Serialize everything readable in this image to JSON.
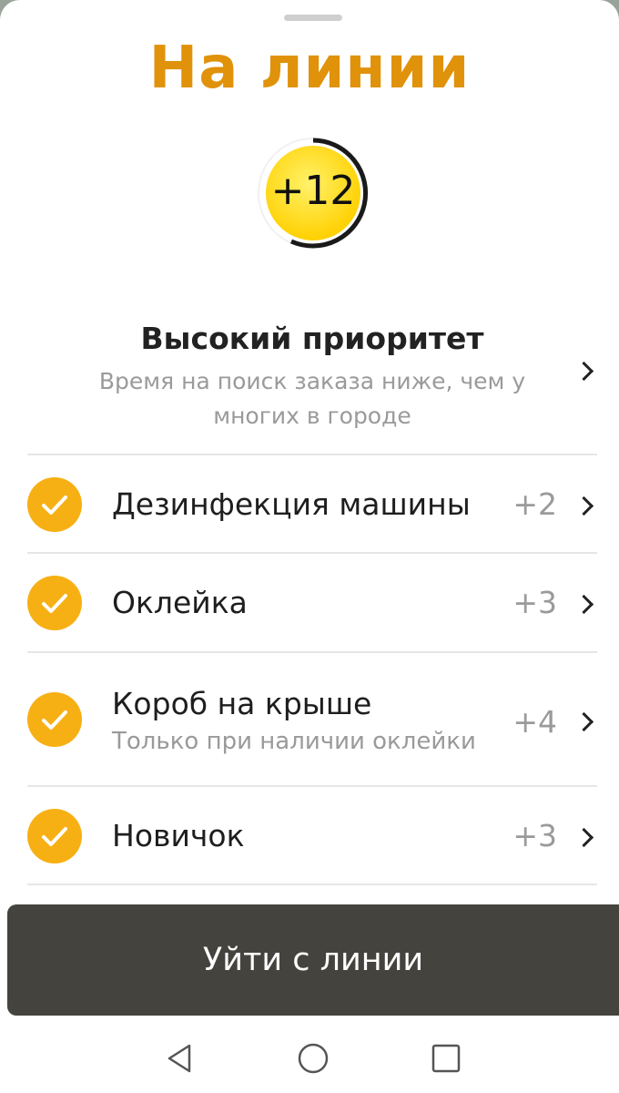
{
  "header": {
    "title": "На линии"
  },
  "badge": {
    "value": "+12"
  },
  "priority": {
    "title": "Высокий приоритет",
    "subtitle": "Время на поиск заказа ниже, чем у многих в городе"
  },
  "items": [
    {
      "label": "Дезинфекция машины",
      "subtitle": "",
      "value": "+2",
      "checked": true
    },
    {
      "label": "Оклейка",
      "subtitle": "",
      "value": "+3",
      "checked": true
    },
    {
      "label": "Короб на крыше",
      "subtitle": "Только при наличии оклейки",
      "value": "+4",
      "checked": true
    },
    {
      "label": "Новичок",
      "subtitle": "",
      "value": "+3",
      "checked": true
    }
  ],
  "footer": {
    "leave_label": "Уйти с линии"
  },
  "navbar": {
    "items": [
      "back-icon",
      "home-icon",
      "recents-icon"
    ]
  },
  "colors": {
    "title": "#e0920a",
    "badge_yellow": "#ffd600",
    "check": "#f7b014",
    "button_bg": "#45433e"
  }
}
